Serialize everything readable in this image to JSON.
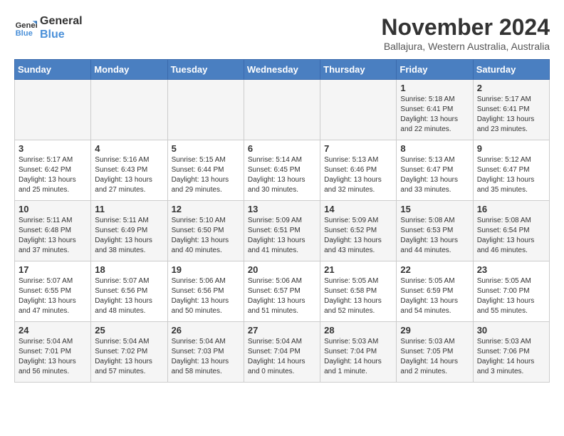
{
  "logo": {
    "line1": "General",
    "line2": "Blue"
  },
  "title": "November 2024",
  "location": "Ballajura, Western Australia, Australia",
  "weekdays": [
    "Sunday",
    "Monday",
    "Tuesday",
    "Wednesday",
    "Thursday",
    "Friday",
    "Saturday"
  ],
  "weeks": [
    [
      {
        "day": "",
        "info": ""
      },
      {
        "day": "",
        "info": ""
      },
      {
        "day": "",
        "info": ""
      },
      {
        "day": "",
        "info": ""
      },
      {
        "day": "",
        "info": ""
      },
      {
        "day": "1",
        "info": "Sunrise: 5:18 AM\nSunset: 6:41 PM\nDaylight: 13 hours\nand 22 minutes."
      },
      {
        "day": "2",
        "info": "Sunrise: 5:17 AM\nSunset: 6:41 PM\nDaylight: 13 hours\nand 23 minutes."
      }
    ],
    [
      {
        "day": "3",
        "info": "Sunrise: 5:17 AM\nSunset: 6:42 PM\nDaylight: 13 hours\nand 25 minutes."
      },
      {
        "day": "4",
        "info": "Sunrise: 5:16 AM\nSunset: 6:43 PM\nDaylight: 13 hours\nand 27 minutes."
      },
      {
        "day": "5",
        "info": "Sunrise: 5:15 AM\nSunset: 6:44 PM\nDaylight: 13 hours\nand 29 minutes."
      },
      {
        "day": "6",
        "info": "Sunrise: 5:14 AM\nSunset: 6:45 PM\nDaylight: 13 hours\nand 30 minutes."
      },
      {
        "day": "7",
        "info": "Sunrise: 5:13 AM\nSunset: 6:46 PM\nDaylight: 13 hours\nand 32 minutes."
      },
      {
        "day": "8",
        "info": "Sunrise: 5:13 AM\nSunset: 6:47 PM\nDaylight: 13 hours\nand 33 minutes."
      },
      {
        "day": "9",
        "info": "Sunrise: 5:12 AM\nSunset: 6:47 PM\nDaylight: 13 hours\nand 35 minutes."
      }
    ],
    [
      {
        "day": "10",
        "info": "Sunrise: 5:11 AM\nSunset: 6:48 PM\nDaylight: 13 hours\nand 37 minutes."
      },
      {
        "day": "11",
        "info": "Sunrise: 5:11 AM\nSunset: 6:49 PM\nDaylight: 13 hours\nand 38 minutes."
      },
      {
        "day": "12",
        "info": "Sunrise: 5:10 AM\nSunset: 6:50 PM\nDaylight: 13 hours\nand 40 minutes."
      },
      {
        "day": "13",
        "info": "Sunrise: 5:09 AM\nSunset: 6:51 PM\nDaylight: 13 hours\nand 41 minutes."
      },
      {
        "day": "14",
        "info": "Sunrise: 5:09 AM\nSunset: 6:52 PM\nDaylight: 13 hours\nand 43 minutes."
      },
      {
        "day": "15",
        "info": "Sunrise: 5:08 AM\nSunset: 6:53 PM\nDaylight: 13 hours\nand 44 minutes."
      },
      {
        "day": "16",
        "info": "Sunrise: 5:08 AM\nSunset: 6:54 PM\nDaylight: 13 hours\nand 46 minutes."
      }
    ],
    [
      {
        "day": "17",
        "info": "Sunrise: 5:07 AM\nSunset: 6:55 PM\nDaylight: 13 hours\nand 47 minutes."
      },
      {
        "day": "18",
        "info": "Sunrise: 5:07 AM\nSunset: 6:56 PM\nDaylight: 13 hours\nand 48 minutes."
      },
      {
        "day": "19",
        "info": "Sunrise: 5:06 AM\nSunset: 6:56 PM\nDaylight: 13 hours\nand 50 minutes."
      },
      {
        "day": "20",
        "info": "Sunrise: 5:06 AM\nSunset: 6:57 PM\nDaylight: 13 hours\nand 51 minutes."
      },
      {
        "day": "21",
        "info": "Sunrise: 5:05 AM\nSunset: 6:58 PM\nDaylight: 13 hours\nand 52 minutes."
      },
      {
        "day": "22",
        "info": "Sunrise: 5:05 AM\nSunset: 6:59 PM\nDaylight: 13 hours\nand 54 minutes."
      },
      {
        "day": "23",
        "info": "Sunrise: 5:05 AM\nSunset: 7:00 PM\nDaylight: 13 hours\nand 55 minutes."
      }
    ],
    [
      {
        "day": "24",
        "info": "Sunrise: 5:04 AM\nSunset: 7:01 PM\nDaylight: 13 hours\nand 56 minutes."
      },
      {
        "day": "25",
        "info": "Sunrise: 5:04 AM\nSunset: 7:02 PM\nDaylight: 13 hours\nand 57 minutes."
      },
      {
        "day": "26",
        "info": "Sunrise: 5:04 AM\nSunset: 7:03 PM\nDaylight: 13 hours\nand 58 minutes."
      },
      {
        "day": "27",
        "info": "Sunrise: 5:04 AM\nSunset: 7:04 PM\nDaylight: 14 hours\nand 0 minutes."
      },
      {
        "day": "28",
        "info": "Sunrise: 5:03 AM\nSunset: 7:04 PM\nDaylight: 14 hours\nand 1 minute."
      },
      {
        "day": "29",
        "info": "Sunrise: 5:03 AM\nSunset: 7:05 PM\nDaylight: 14 hours\nand 2 minutes."
      },
      {
        "day": "30",
        "info": "Sunrise: 5:03 AM\nSunset: 7:06 PM\nDaylight: 14 hours\nand 3 minutes."
      }
    ]
  ]
}
